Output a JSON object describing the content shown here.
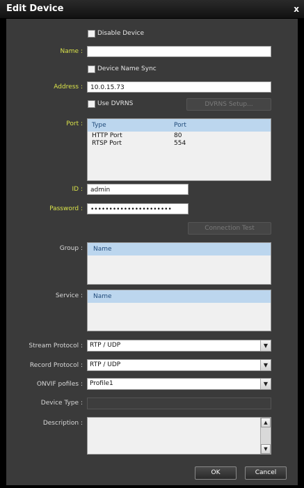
{
  "window": {
    "title": "Edit Device",
    "close_glyph": "x"
  },
  "form": {
    "disable_device": "Disable Device",
    "name_label": "Name :",
    "name_value": "",
    "device_name_sync": "Device Name Sync",
    "address_label": "Address :",
    "address_value": "10.0.15.73",
    "use_dvrns": "Use DVRNS",
    "dvrns_setup": "DVRNS Setup...",
    "port_label": "Port :",
    "port_columns": [
      "Type",
      "Port"
    ],
    "port_rows": [
      {
        "type": "HTTP Port",
        "port": "80"
      },
      {
        "type": "RTSP Port",
        "port": "554"
      }
    ],
    "id_label": "ID :",
    "id_value": "admin",
    "password_label": "Password :",
    "password_value": "••••••••••••••••••••••",
    "connection_test": "Connection Test",
    "group_label": "Group :",
    "group_header": "Name",
    "service_label": "Service :",
    "service_header": "Name",
    "stream_protocol_label": "Stream Protocol :",
    "stream_protocol_value": "RTP / UDP",
    "record_protocol_label": "Record Protocol :",
    "record_protocol_value": "RTP / UDP",
    "onvif_label": "ONVIF pofiles :",
    "onvif_value": "Profile1",
    "device_type_label": "Device Type :",
    "device_type_value": "",
    "description_label": "Description :",
    "description_value": ""
  },
  "buttons": {
    "ok": "OK",
    "cancel": "Cancel"
  },
  "colors": {
    "label_highlight": "#d9e24a",
    "list_header": "#bcd6ee",
    "panel": "#3a3a3a"
  }
}
